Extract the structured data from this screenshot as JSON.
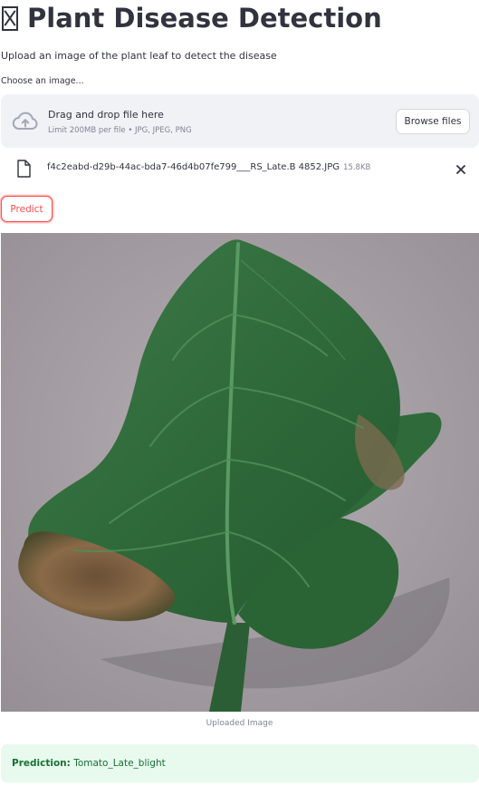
{
  "header": {
    "title": "Plant Disease Detection",
    "title_emoji_icon": "missing-glyph-icon",
    "subtitle": "Upload an image of the plant leaf to detect the disease"
  },
  "uploader": {
    "label": "Choose an image...",
    "drop_text": "Drag and drop file here",
    "limits_text": "Limit 200MB per file • JPG, JPEG, PNG",
    "browse_label": "Browse files",
    "upload_icon": "cloud-upload-icon"
  },
  "uploaded_file": {
    "name": "f4c2eabd-d29b-44ac-bda7-46d4b07fe799___RS_Late.B 4852.JPG",
    "size": "15.8KB",
    "file_icon": "file-icon",
    "remove_icon": "close-icon"
  },
  "actions": {
    "predict_label": "Predict"
  },
  "image": {
    "caption": "Uploaded Image",
    "subject": "tomato leaf with late blight lesions"
  },
  "result": {
    "prefix": "Prediction:",
    "value": "Tomato_Late_blight"
  },
  "colors": {
    "accent": "#ff4b4b",
    "dropzone_bg": "#f0f2f6",
    "success_bg": "#e8f9ee",
    "success_text": "#177233",
    "muted_text": "#808495",
    "text": "#31333f"
  }
}
